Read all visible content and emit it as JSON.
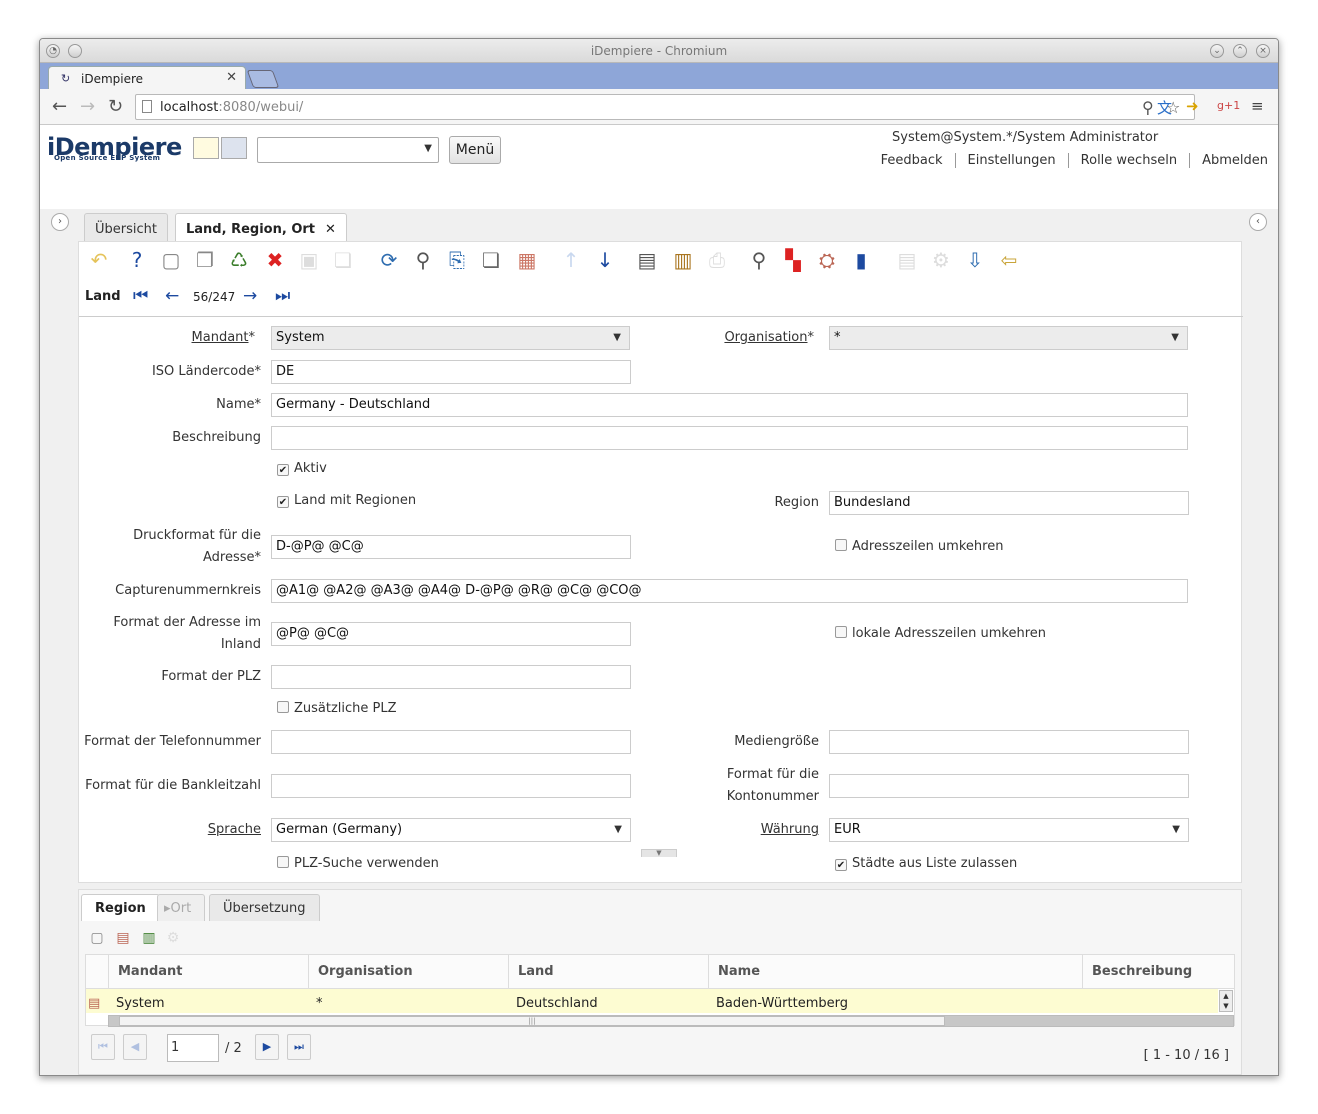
{
  "browser": {
    "window_title": "iDempiere - Chromium",
    "tab_title": "iDempiere",
    "url_host": "localhost",
    "url_path": ":8080/webui/"
  },
  "app": {
    "logo": "iDempiere",
    "logo_sub": "Open Source ERP System",
    "menu_button": "Menü",
    "user_info": "System@System.*/System Administrator",
    "links": [
      "Feedback",
      "Einstellungen",
      "Rolle wechseln",
      "Abmelden"
    ]
  },
  "window_tabs": [
    {
      "label": "Übersicht"
    },
    {
      "label": "Land, Region, Ort"
    }
  ],
  "record_nav": {
    "label": "Land",
    "counter": "56/247"
  },
  "form": {
    "mandant": {
      "label": "Mandant",
      "value": "System"
    },
    "organisation": {
      "label": "Organisation",
      "value": "*"
    },
    "iso": {
      "label": "ISO Ländercode",
      "value": "DE"
    },
    "name": {
      "label": "Name",
      "value": "Germany - Deutschland"
    },
    "beschreibung": {
      "label": "Beschreibung",
      "value": ""
    },
    "aktiv": {
      "label": "Aktiv",
      "checked": true
    },
    "land_mit_regionen": {
      "label": "Land mit Regionen",
      "checked": true
    },
    "region": {
      "label": "Region",
      "value": "Bundesland"
    },
    "druckformat": {
      "label_line1": "Druckformat für die",
      "label_line2": "Adresse",
      "value": "D-@P@ @C@"
    },
    "adresszeilen_umkehren": {
      "label": "Adresszeilen umkehren",
      "checked": false
    },
    "capture": {
      "label": "Capturenummernkreis",
      "value": "@A1@ @A2@ @A3@ @A4@ D-@P@ @R@ @C@ @CO@"
    },
    "format_inland": {
      "label_line1": "Format der Adresse im",
      "label_line2": "Inland",
      "value": "@P@ @C@"
    },
    "lokale_umkehren": {
      "label": "lokale Adresszeilen umkehren",
      "checked": false
    },
    "format_plz": {
      "label": "Format der PLZ",
      "value": ""
    },
    "zus_plz": {
      "label": "Zusätzliche PLZ",
      "checked": false
    },
    "format_tel": {
      "label": "Format der Telefonnummer",
      "value": ""
    },
    "mediengroesse": {
      "label": "Mediengröße",
      "value": ""
    },
    "format_blz": {
      "label": "Format für die Bankleitzahl",
      "value": ""
    },
    "format_konto": {
      "label_line1": "Format für die",
      "label_line2": "Kontonummer",
      "value": ""
    },
    "sprache": {
      "label": "Sprache",
      "value": "German (Germany)"
    },
    "waehrung": {
      "label": "Währung",
      "value": "EUR"
    },
    "plz_suche": {
      "label": "PLZ-Suche verwenden",
      "checked": false
    },
    "staedte_liste": {
      "label": "Städte aus Liste zulassen",
      "checked": true
    }
  },
  "detail": {
    "tabs": [
      "Region",
      "Ort",
      "Übersetzung"
    ],
    "columns": [
      "Mandant",
      "Organisation",
      "Land",
      "Name",
      "Beschreibung"
    ],
    "rows": [
      {
        "mandant": "System",
        "organisation": "*",
        "land": "Deutschland",
        "name": "Baden-Württemberg",
        "beschreibung": ""
      }
    ],
    "pager": {
      "page": "1",
      "total": "/ 2",
      "info": "[ 1 - 10 / 16 ]"
    }
  }
}
